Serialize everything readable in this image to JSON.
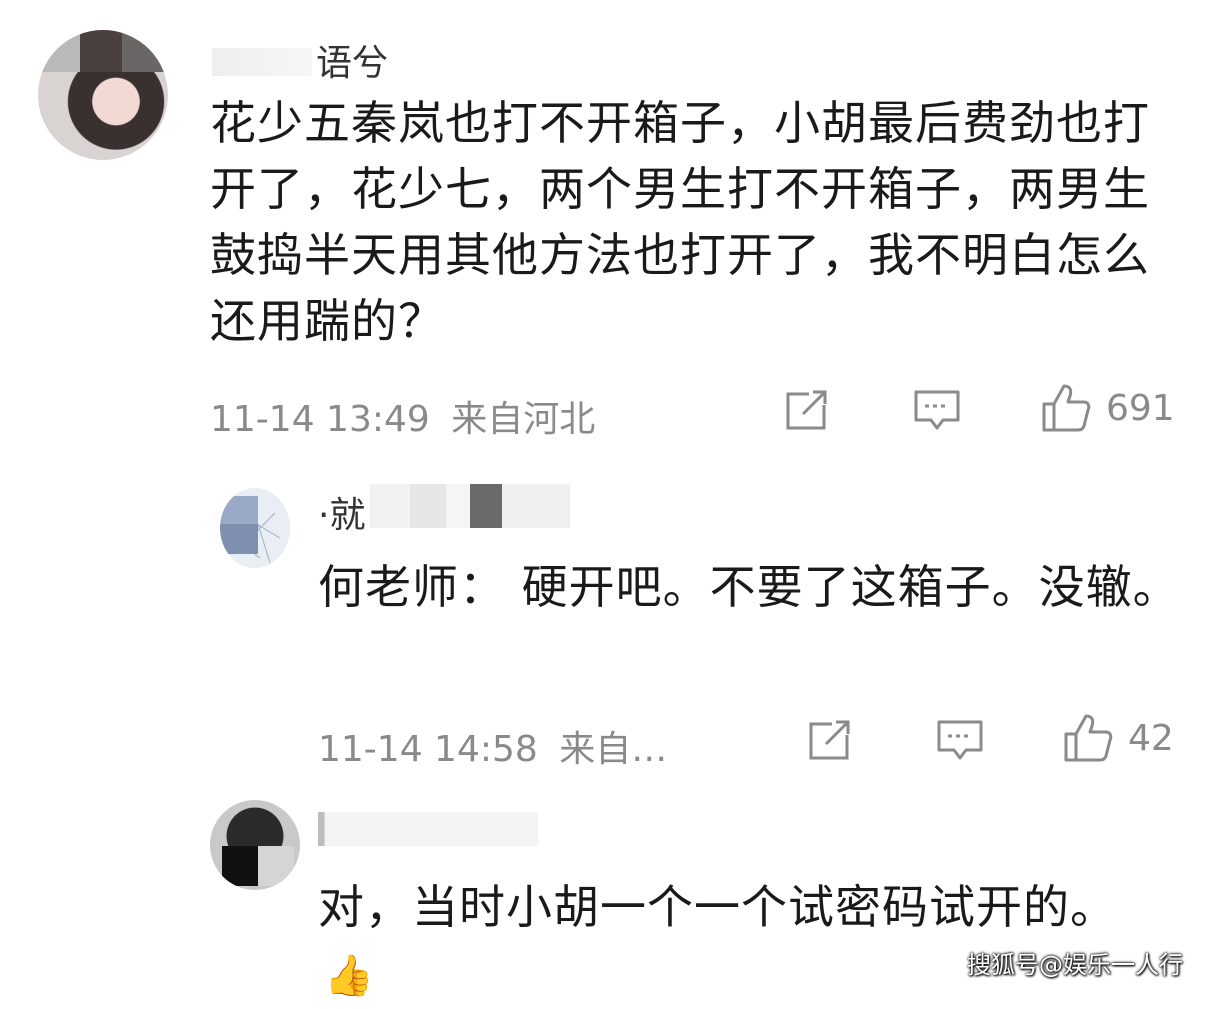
{
  "comments": [
    {
      "username": "语兮",
      "text": "花少五秦岚也打不开箱子，小胡最后费劲也打开了，花少七，两个男生打不开箱子，两男生鼓捣半天用其他方法也打开了，我不明白怎么还用踹的？",
      "time": "11-14 13:49",
      "location": "来自河北",
      "likes": "691"
    },
    {
      "username": "·就",
      "text": "何老师：  硬开吧。不要了这箱子。没辙。",
      "time": "11-14 14:58",
      "location": "来自…",
      "likes": "42"
    },
    {
      "username": "",
      "text": "对，当时小胡一个一个试密码试开的。",
      "emoji": "👍"
    }
  ],
  "icons": {
    "share": "share-icon",
    "reply": "reply-icon",
    "like": "thumbs-up-icon"
  },
  "watermark": "搜狐号@娱乐一人行"
}
